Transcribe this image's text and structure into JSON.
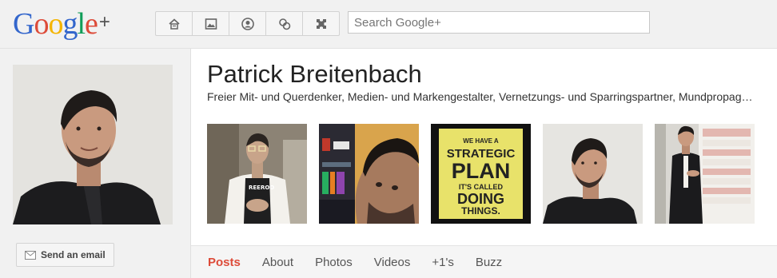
{
  "logo": {
    "text": "Google",
    "plus": "+"
  },
  "nav": {
    "icons": [
      "home-icon",
      "photos-icon",
      "profile-icon",
      "circles-icon",
      "games-icon"
    ]
  },
  "search": {
    "placeholder": "Search Google+"
  },
  "profile": {
    "name": "Patrick Breitenbach",
    "tagline": "Freier Mit- und Querdenker, Medien- und Markengestalter, Vernetzungs- und Sparringspartner, Mundpropaganda",
    "email_button": "Send an email"
  },
  "poster": {
    "line1": "WE HAVE A",
    "line2": "STRATEGIC",
    "line3": "PLAN",
    "line4": "IT'S CALLED",
    "line5": "DOING",
    "line6": "THINGS."
  },
  "tabs": [
    {
      "label": "Posts",
      "active": true
    },
    {
      "label": "About",
      "active": false
    },
    {
      "label": "Photos",
      "active": false
    },
    {
      "label": "Videos",
      "active": false
    },
    {
      "label": "+1's",
      "active": false
    },
    {
      "label": "Buzz",
      "active": false
    }
  ],
  "colors": {
    "active_tab": "#dd4b39",
    "g_blue": "#3366cc",
    "g_red": "#dd4b39",
    "g_yellow": "#f4b400",
    "g_green": "#109d58"
  }
}
